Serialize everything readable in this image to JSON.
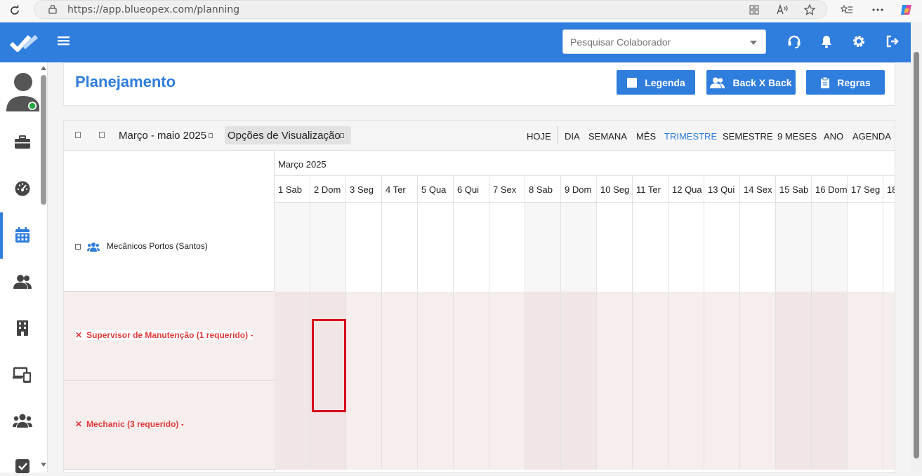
{
  "browser": {
    "url": "https://app.blueopex.com/planning"
  },
  "topbar": {
    "search_placeholder": "Pesquisar Colaborador"
  },
  "page": {
    "title": "Planejamento",
    "buttons": {
      "legenda": "Legenda",
      "backxback": "Back X Back",
      "regras": "Regras"
    }
  },
  "toolbar": {
    "range": "Março - maio 2025",
    "view_options": "Opções de Visualização",
    "views": [
      "HOJE",
      "DIA",
      "SEMANA",
      "MÊS",
      "TRIMESTRE",
      "SEMESTRE",
      "9 MESES",
      "ANO",
      "AGENDA"
    ],
    "active_view": "TRIMESTRE"
  },
  "calendar": {
    "month": "Março 2025",
    "days": [
      "1 Sab",
      "2 Dom",
      "3 Seg",
      "4 Ter",
      "5 Qua",
      "6 Qui",
      "7 Sex",
      "8 Sab",
      "9 Dom",
      "10 Seg",
      "11 Ter",
      "12 Qua",
      "13 Qui",
      "14 Sex",
      "15 Sab",
      "16 Dom",
      "17 Seg",
      "18"
    ],
    "weekend_columns": [
      0,
      1,
      7,
      8,
      14,
      15
    ],
    "rows": [
      {
        "label": "Mecânicos Portos (Santos)",
        "type": "group"
      },
      {
        "label": "Supervisor de Manutenção (1 requerido) -",
        "type": "requirement"
      },
      {
        "label": "Mechanic (3 requerido) -",
        "type": "requirement"
      }
    ],
    "selected_cell": {
      "row": 1,
      "day": "2 Dom"
    }
  },
  "colors": {
    "brand": "#2f7ddd",
    "error": "#e03a3a",
    "requirement_bg": "#f6eded",
    "selected": "#d9001b"
  }
}
